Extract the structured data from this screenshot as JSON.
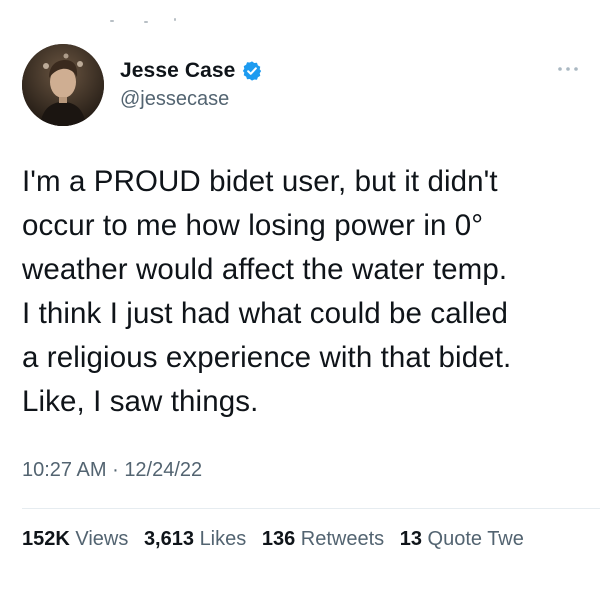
{
  "tweet": {
    "author": {
      "display_name": "Jesse Case",
      "handle": "@jessecase",
      "verified": true,
      "verified_icon": "verified-badge-icon",
      "verified_color": "#1d9bf0"
    },
    "text": "I'm a PROUD bidet user, but it didn't\noccur to me how losing power in 0°\nweather would affect the water temp.\nI think I just had what could be called\na religious experience with that bidet.\nLike, I saw things.",
    "time": "10:27 AM",
    "separator": "·",
    "date": "12/24/22",
    "stats": [
      {
        "count": "152K",
        "label": "Views"
      },
      {
        "count": "3,613",
        "label": "Likes"
      },
      {
        "count": "136",
        "label": "Retweets"
      },
      {
        "count": "13",
        "label": "Quote Twe"
      }
    ],
    "more_icon": "more-horizontal-icon"
  },
  "colors": {
    "primary_text": "#0f1419",
    "secondary_text": "#536471",
    "divider": "#e6ecf0"
  }
}
